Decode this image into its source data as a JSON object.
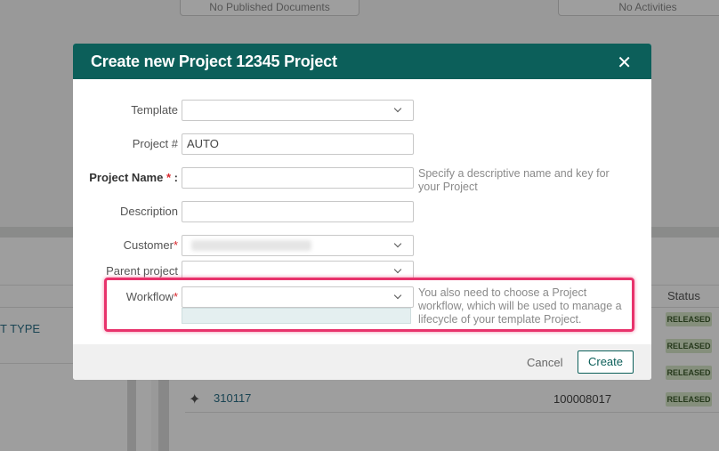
{
  "background": {
    "published_label": "No Published Documents",
    "activities_label": "No Activities",
    "left_link": "T TYPE",
    "status_header": "Status",
    "status_badges": [
      "RELEASED",
      "RELEASED",
      "RELEASED",
      "RELEASED"
    ],
    "row": {
      "id": "310117",
      "number": "100008017"
    }
  },
  "modal": {
    "title": "Create new Project 12345 Project",
    "close_icon": "close-icon",
    "fields": {
      "template": {
        "label": "Template",
        "value": ""
      },
      "project_number": {
        "label": "Project #",
        "value": "AUTO"
      },
      "project_name": {
        "label": "Project Name",
        "required_mark": "*",
        "suffix": ":",
        "value": "",
        "help": "Specify a descriptive name and key for your Project"
      },
      "description": {
        "label": "Description",
        "value": ""
      },
      "customer": {
        "label": "Customer",
        "required_mark": "*"
      },
      "parent_project": {
        "label": "Parent project",
        "value": ""
      },
      "workflow": {
        "label": "Workflow",
        "required_mark": "*",
        "value": "",
        "help": "You also need to choose a Project workflow, which will be used to manage a lifecycle of your template Project."
      }
    },
    "footer": {
      "cancel_label": "Cancel",
      "create_label": "Create"
    }
  },
  "colors": {
    "header": "#0c5f5a",
    "highlight": "#e8336c",
    "required": "#d9262c"
  }
}
